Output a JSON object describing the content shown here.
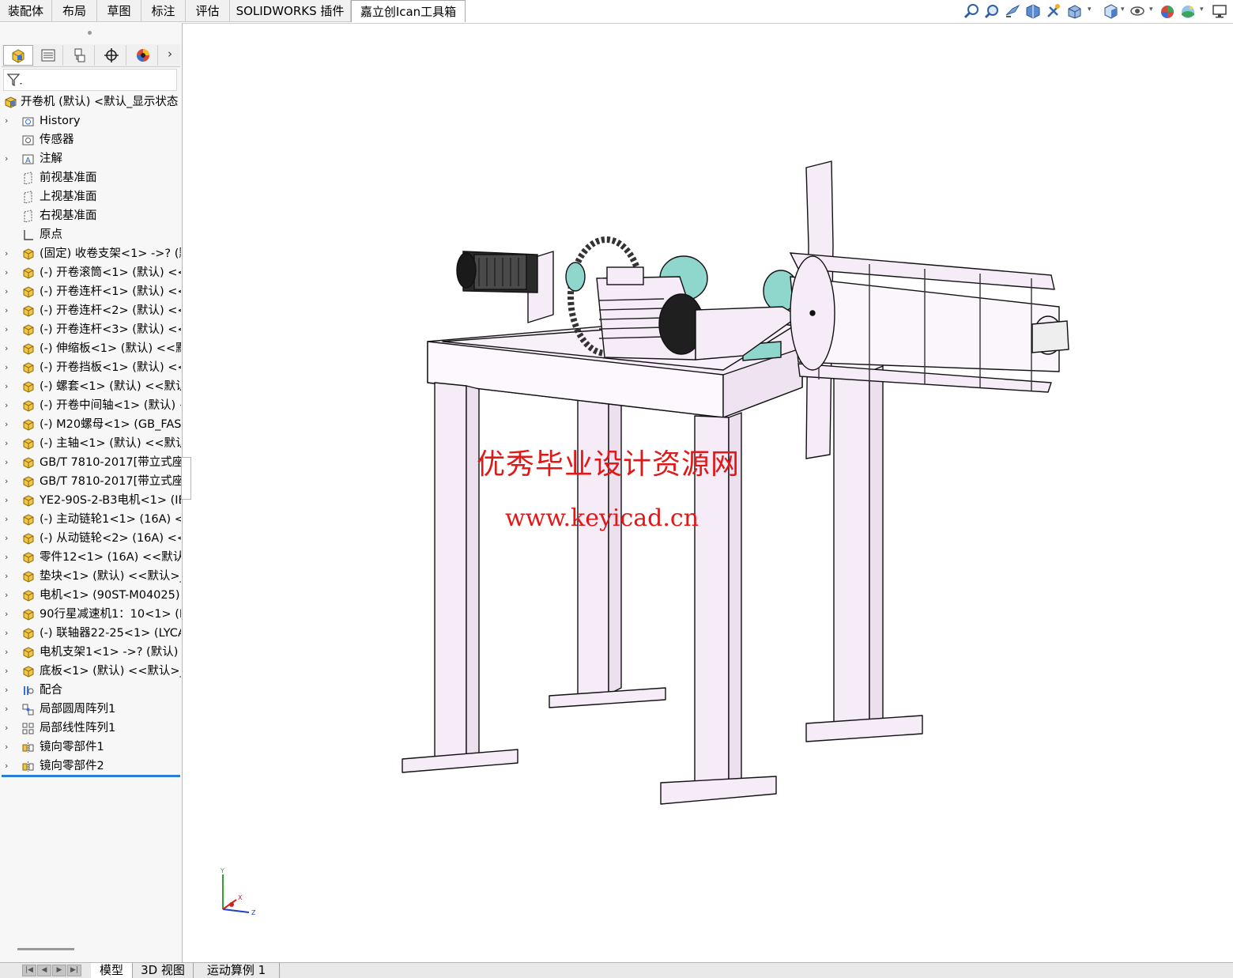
{
  "command_tabs": [
    "装配体",
    "布局",
    "草图",
    "标注",
    "评估",
    "SOLIDWORKS 插件",
    "嘉立创Ican工具箱"
  ],
  "active_command_tab": "嘉立创Ican工具箱",
  "view_tools": [
    "zoom-to-fit-icon",
    "zoom-area-icon",
    "previous-view-icon",
    "section-view-icon",
    "dynamic-annotation-icon",
    "view-orientation-icon",
    "display-style-icon",
    "hide-show-icon",
    "appearance-icon",
    "scene-icon",
    "monitor-icon"
  ],
  "panel_tabs": [
    "feature-manager-icon",
    "property-manager-icon",
    "configuration-manager-icon",
    "dimxpert-icon",
    "display-manager-icon"
  ],
  "tree": {
    "root": "开卷机 (默认) <默认_显示状态",
    "items": [
      {
        "label": "History",
        "icon": "history-folder-icon",
        "expand": true
      },
      {
        "label": "传感器",
        "icon": "sensor-icon",
        "expand": false
      },
      {
        "label": "注解",
        "icon": "annotation-icon",
        "expand": true
      },
      {
        "label": "前视基准面",
        "icon": "plane-icon",
        "expand": false
      },
      {
        "label": "上视基准面",
        "icon": "plane-icon",
        "expand": false
      },
      {
        "label": "右视基准面",
        "icon": "plane-icon",
        "expand": false
      },
      {
        "label": "原点",
        "icon": "origin-icon",
        "expand": false
      },
      {
        "label": "(固定) 收卷支架<1> ->? (默",
        "icon": "part-icon",
        "expand": true
      },
      {
        "label": "(-) 开卷滚筒<1> (默认) <<",
        "icon": "part-icon",
        "expand": true
      },
      {
        "label": "(-) 开卷连杆<1> (默认) <<",
        "icon": "part-icon",
        "expand": true
      },
      {
        "label": "(-) 开卷连杆<2> (默认) <<",
        "icon": "part-icon",
        "expand": true
      },
      {
        "label": "(-) 开卷连杆<3> (默认) <<",
        "icon": "part-icon",
        "expand": true
      },
      {
        "label": "(-) 伸缩板<1> (默认) <<默",
        "icon": "part-icon",
        "expand": true
      },
      {
        "label": "(-) 开卷挡板<1> (默认) <<",
        "icon": "part-icon",
        "expand": true
      },
      {
        "label": "(-) 螺套<1> (默认) <<默认",
        "icon": "part-icon",
        "expand": true
      },
      {
        "label": "(-) 开卷中间轴<1> (默认) <",
        "icon": "part-icon",
        "expand": true
      },
      {
        "label": "(-) M20螺母<1> (GB_FAS",
        "icon": "part-icon",
        "expand": true
      },
      {
        "label": "(-) 主轴<1> (默认) <<默认",
        "icon": "part-icon",
        "expand": true
      },
      {
        "label": "GB/T 7810-2017[带立式座",
        "icon": "part-icon",
        "expand": true
      },
      {
        "label": "GB/T 7810-2017[带立式座",
        "icon": "part-icon",
        "expand": true
      },
      {
        "label": "YE2-90S-2-B3电机<1> (IE",
        "icon": "part-icon",
        "expand": true
      },
      {
        "label": "(-) 主动链轮1<1> (16A) <",
        "icon": "part-icon",
        "expand": true
      },
      {
        "label": "(-) 从动链轮<2> (16A) <<",
        "icon": "part-icon",
        "expand": true
      },
      {
        "label": "零件12<1> (16A) <<默认",
        "icon": "part-icon",
        "expand": true
      },
      {
        "label": "垫块<1> (默认) <<默认>_",
        "icon": "part-icon",
        "expand": true
      },
      {
        "label": "电机<1> (90ST-M04025)",
        "icon": "part-icon",
        "expand": true
      },
      {
        "label": "90行星减速机1：10<1> (I",
        "icon": "part-icon",
        "expand": true
      },
      {
        "label": "(-) 联轴器22-25<1> (LYCA",
        "icon": "part-icon",
        "expand": true
      },
      {
        "label": "电机支架1<1> ->? (默认)",
        "icon": "part-icon",
        "expand": true
      },
      {
        "label": "底板<1> (默认) <<默认>_",
        "icon": "part-icon",
        "expand": true
      },
      {
        "label": "配合",
        "icon": "mates-icon",
        "expand": true
      },
      {
        "label": "局部圆周阵列1",
        "icon": "circular-pattern-icon",
        "expand": true
      },
      {
        "label": "局部线性阵列1",
        "icon": "linear-pattern-icon",
        "expand": true
      },
      {
        "label": "镜向零部件1",
        "icon": "mirror-component-icon",
        "expand": true
      },
      {
        "label": "镜向零部件2",
        "icon": "mirror-component-icon",
        "expand": true
      }
    ]
  },
  "bottom_tabs": [
    "模型",
    "3D 视图",
    "运动算例 1"
  ],
  "active_bottom_tab": "模型",
  "watermark": {
    "line1": "优秀毕业设计资源网",
    "line2": "www.keyicad.cn"
  },
  "triad": {
    "x": "X",
    "y": "Y",
    "z": "Z"
  },
  "colors": {
    "part_fill": "#f6ecf8",
    "accent": "#2a7fd4",
    "watermark": "#e01818",
    "teal": "#8fd6cc"
  }
}
